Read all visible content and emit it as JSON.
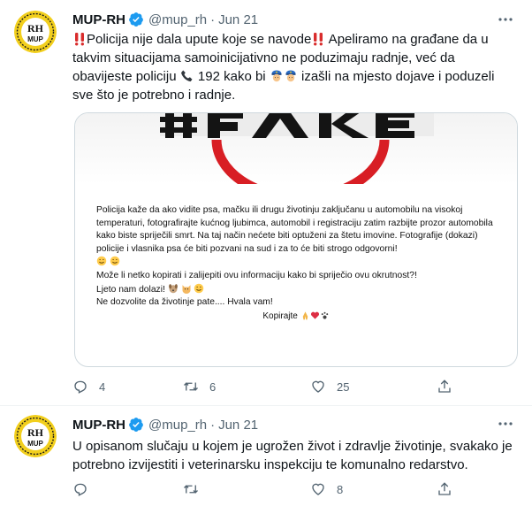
{
  "tweets": [
    {
      "name": "MUP-RH",
      "handle": "@mup_rh",
      "sep": "·",
      "date": "Jun 21",
      "avatar_text": [
        "RH",
        "MUP"
      ],
      "text": {
        "seg1": "Policija nije dala upute koje se navode",
        "seg2": " Apeliramo na građane da u takvim situacijama samoinicijativno ne poduzimaju radnje, već da obavijeste policiju ",
        "seg3": " 192 kako bi ",
        "seg4": " izašli na mjesto dojave i poduzeli sve što je potrebno i radnje."
      },
      "image": {
        "paragraph1": "Policija kaže da ako vidite psa, mačku ili drugu životinju zaključanu u automobilu na visokoj temperaturi, fotografirajte kućnog ljubimca, automobil i registraciju zatim razbijte prozor automobila kako biste spriječili smrt. Na taj način nećete biti optuženi za štetu imovine. Fotografije (dokazi) policije i vlasnika psa će biti pozvani na sud i za to će biti strogo odgovorni!",
        "line2": "Može li netko kopirati i zalijepiti ovu informaciju kako bi spriječio ovu okrutnost?!",
        "line3": "Ljeto nam dolazi!",
        "line4": "Ne dozvolite da životinje pate.... Hvala vam!",
        "sign": "Kopirajte"
      },
      "counts": {
        "reply": "4",
        "retweet": "6",
        "like": "25"
      }
    },
    {
      "name": "MUP-RH",
      "handle": "@mup_rh",
      "sep": "·",
      "date": "Jun 21",
      "avatar_text": [
        "RH",
        "MUP"
      ],
      "text": "U opisanom slučaju u kojem je ugrožen život i zdravlje životinje, svakako je potrebno izvijestiti i veterinarsku inspekciju te komunalno redarstvo.",
      "counts": {
        "reply": "",
        "retweet": "",
        "like": "8"
      }
    }
  ],
  "colors": {
    "verified": "#1d9bf0",
    "muted": "#536471",
    "text": "#0f1419",
    "border": "#cfd9de",
    "badge_yellow": "#f2cf1d"
  }
}
